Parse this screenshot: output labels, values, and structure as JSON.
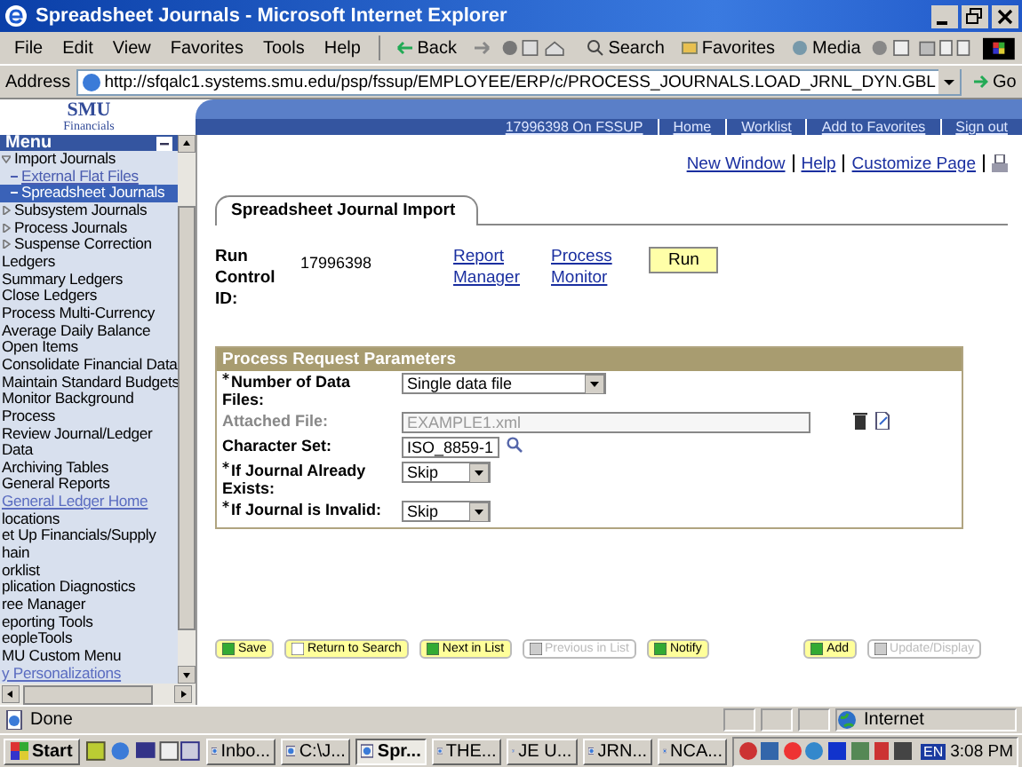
{
  "window": {
    "title": "Spreadsheet Journals - Microsoft Internet Explorer"
  },
  "menu_bar": [
    "File",
    "Edit",
    "View",
    "Favorites",
    "Tools",
    "Help"
  ],
  "toolbar": [
    {
      "kind": "back",
      "label": "Back"
    },
    {
      "kind": "forward"
    },
    {
      "kind": "search",
      "label": "Search"
    },
    {
      "kind": "favorites",
      "label": "Favorites"
    },
    {
      "kind": "media",
      "label": "Media"
    }
  ],
  "address_bar": {
    "label": "Address",
    "url": "http://sfqalc1.systems.smu.edu/psp/fssup/EMPLOYEE/ERP/c/PROCESS_JOURNALS.LOAD_JRNL_DYN.GBL",
    "go": "Go"
  },
  "banner": {
    "logo": "SMU",
    "logo_sub": "Financials",
    "links": [
      "17996398 On FSSUP",
      "Home",
      "Worklist",
      "Add to Favorites",
      "Sign out"
    ]
  },
  "sidebar": {
    "title": "Menu",
    "items": [
      {
        "label": "Import Journals",
        "kind": "expanded",
        "selected": false
      },
      {
        "label": "External Flat Files",
        "kind": "sub",
        "selected": false
      },
      {
        "label": "Spreadsheet Journals",
        "kind": "sub",
        "selected": true
      },
      {
        "label": "Subsystem Journals",
        "kind": "collapsed",
        "selected": false
      },
      {
        "label": "Process Journals",
        "kind": "collapsed",
        "selected": false
      },
      {
        "label": "Suspense Correction",
        "kind": "collapsed",
        "selected": false
      },
      {
        "label": "Ledgers",
        "kind": "plain",
        "selected": false
      },
      {
        "label": "Summary Ledgers",
        "kind": "plain",
        "selected": false
      },
      {
        "label": "Close Ledgers",
        "kind": "plain",
        "selected": false
      },
      {
        "label": "Process Multi-Currency",
        "kind": "plain",
        "selected": false
      },
      {
        "label": "Average Daily Balance",
        "kind": "plain",
        "selected": false
      },
      {
        "label": "Open Items",
        "kind": "plain",
        "selected": false
      },
      {
        "label": "Consolidate Financial Data",
        "kind": "plain",
        "selected": false
      },
      {
        "label": "Maintain Standard Budgets",
        "kind": "plain",
        "selected": false
      },
      {
        "label": "Monitor Background",
        "kind": "plain",
        "selected": false
      },
      {
        "label": "Process",
        "kind": "plain",
        "selected": false
      },
      {
        "label": "Review Journal/Ledger",
        "kind": "plain",
        "selected": false
      },
      {
        "label": "Data",
        "kind": "plain",
        "selected": false
      },
      {
        "label": "Archiving Tables",
        "kind": "plain",
        "selected": false
      },
      {
        "label": "General Reports",
        "kind": "plain",
        "selected": false
      },
      {
        "label": "General Ledger Home",
        "kind": "link",
        "selected": false
      },
      {
        "label": "locations",
        "kind": "plain",
        "selected": false
      },
      {
        "label": "et Up Financials/Supply",
        "kind": "plain",
        "selected": false
      },
      {
        "label": "hain",
        "kind": "plain",
        "selected": false
      },
      {
        "label": "orklist",
        "kind": "plain",
        "selected": false
      },
      {
        "label": "plication Diagnostics",
        "kind": "plain",
        "selected": false
      },
      {
        "label": "ree Manager",
        "kind": "plain",
        "selected": false
      },
      {
        "label": "eporting Tools",
        "kind": "plain",
        "selected": false
      },
      {
        "label": "eopleTools",
        "kind": "plain",
        "selected": false
      },
      {
        "label": "MU Custom Menu",
        "kind": "plain",
        "selected": false
      },
      {
        "label": "y Personalizations",
        "kind": "link",
        "selected": false
      }
    ]
  },
  "page_links": [
    "New Window",
    "Help",
    "Customize Page"
  ],
  "tab": {
    "label": "Spreadsheet Journal Import"
  },
  "run_control": {
    "label": "Run Control ID:",
    "value": "17996398",
    "links": [
      "Report Manager",
      "Process Monitor"
    ],
    "run_button": "Run"
  },
  "parameters": {
    "title": "Process Request Parameters",
    "fields": [
      {
        "label": "Number of Data Files:",
        "required": true,
        "disabled": false,
        "kind": "select",
        "value": "Single data file"
      },
      {
        "label": "Attached File:",
        "required": false,
        "disabled": true,
        "kind": "file",
        "value": "EXAMPLE1.xml"
      },
      {
        "label": "Character Set:",
        "required": false,
        "disabled": false,
        "kind": "lookup",
        "value": "ISO_8859-1"
      },
      {
        "label": "If Journal Already Exists:",
        "required": true,
        "disabled": false,
        "kind": "short-select",
        "value": "Skip"
      },
      {
        "label": "If Journal is Invalid:",
        "required": true,
        "disabled": false,
        "kind": "short-select",
        "value": "Skip"
      }
    ]
  },
  "page_buttons": [
    {
      "label": "Save",
      "disabled": false,
      "kind": "save"
    },
    {
      "label": "Return to Search",
      "disabled": false,
      "kind": "search"
    },
    {
      "label": "Next in List",
      "disabled": false,
      "kind": "next"
    },
    {
      "label": "Previous in List",
      "disabled": true,
      "kind": "prev"
    },
    {
      "label": "Notify",
      "disabled": false,
      "kind": "notify"
    },
    {
      "label": "Add",
      "disabled": false,
      "kind": "add"
    },
    {
      "label": "Update/Display",
      "disabled": true,
      "kind": "update"
    }
  ],
  "status_bar": {
    "text": "Done",
    "zone": "Internet"
  },
  "taskbar": {
    "start": "Start",
    "tasks": [
      {
        "label": "Inbo...",
        "selected": false
      },
      {
        "label": "C:\\J...",
        "selected": false
      },
      {
        "label": "Spr...",
        "selected": true
      },
      {
        "label": "THE...",
        "selected": false
      },
      {
        "label": "JE U...",
        "selected": false
      },
      {
        "label": "JRN...",
        "selected": false
      },
      {
        "label": "NCA...",
        "selected": false
      }
    ],
    "language": "EN",
    "clock": "3:08 PM"
  }
}
